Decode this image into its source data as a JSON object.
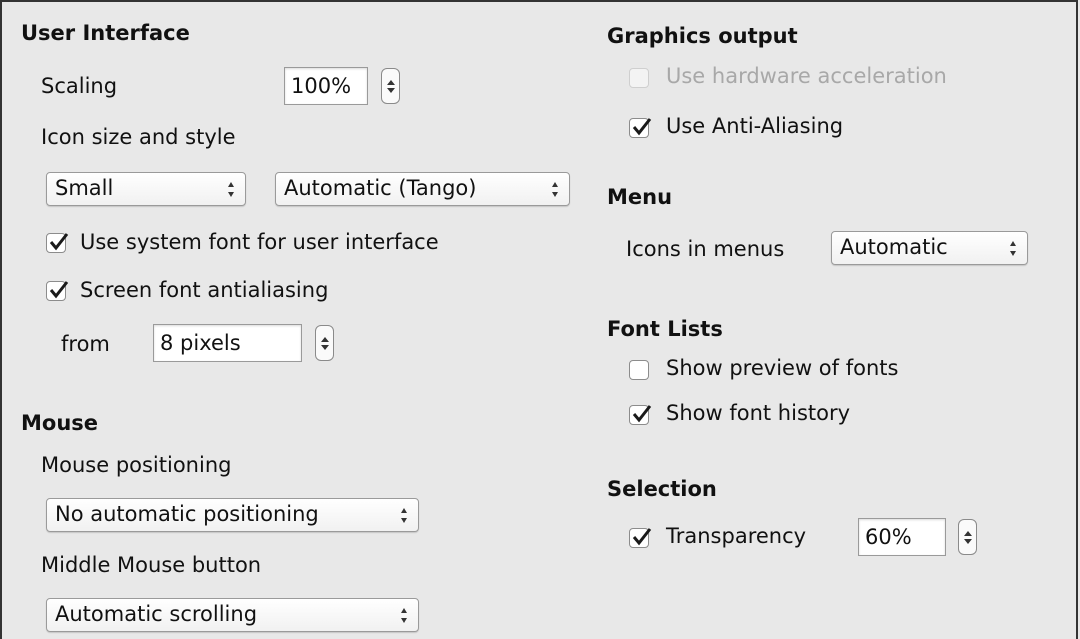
{
  "ui": {
    "heading": "User Interface",
    "scaling_label": "Scaling",
    "scaling_value": "100%",
    "icon_size_label": "Icon size and style",
    "icon_size_value": "Small",
    "icon_style_value": "Automatic (Tango)",
    "system_font_label": "Use system font for user interface",
    "system_font_checked": true,
    "antialiasing_label": "Screen font antialiasing",
    "antialiasing_checked": true,
    "from_label": "from",
    "from_value": "8 pixels"
  },
  "mouse": {
    "heading": "Mouse",
    "positioning_label": "Mouse positioning",
    "positioning_value": "No automatic positioning",
    "middle_label": "Middle Mouse button",
    "middle_value": "Automatic scrolling"
  },
  "graphics": {
    "heading": "Graphics output",
    "hw_accel_label": "Use hardware acceleration",
    "hw_accel_checked": false,
    "hw_accel_enabled": false,
    "antialias_label": "Use Anti-Aliasing",
    "antialias_checked": true
  },
  "menu": {
    "heading": "Menu",
    "icons_label": "Icons in menus",
    "icons_value": "Automatic"
  },
  "font_lists": {
    "heading": "Font Lists",
    "preview_label": "Show preview of fonts",
    "preview_checked": false,
    "history_label": "Show font history",
    "history_checked": true
  },
  "selection": {
    "heading": "Selection",
    "transparency_label": "Transparency",
    "transparency_checked": true,
    "transparency_value": "60%"
  },
  "colors": {
    "checkmark": "#1a1a1a",
    "disabled_text": "#a8a8a8",
    "background": "#e8e8e8"
  }
}
